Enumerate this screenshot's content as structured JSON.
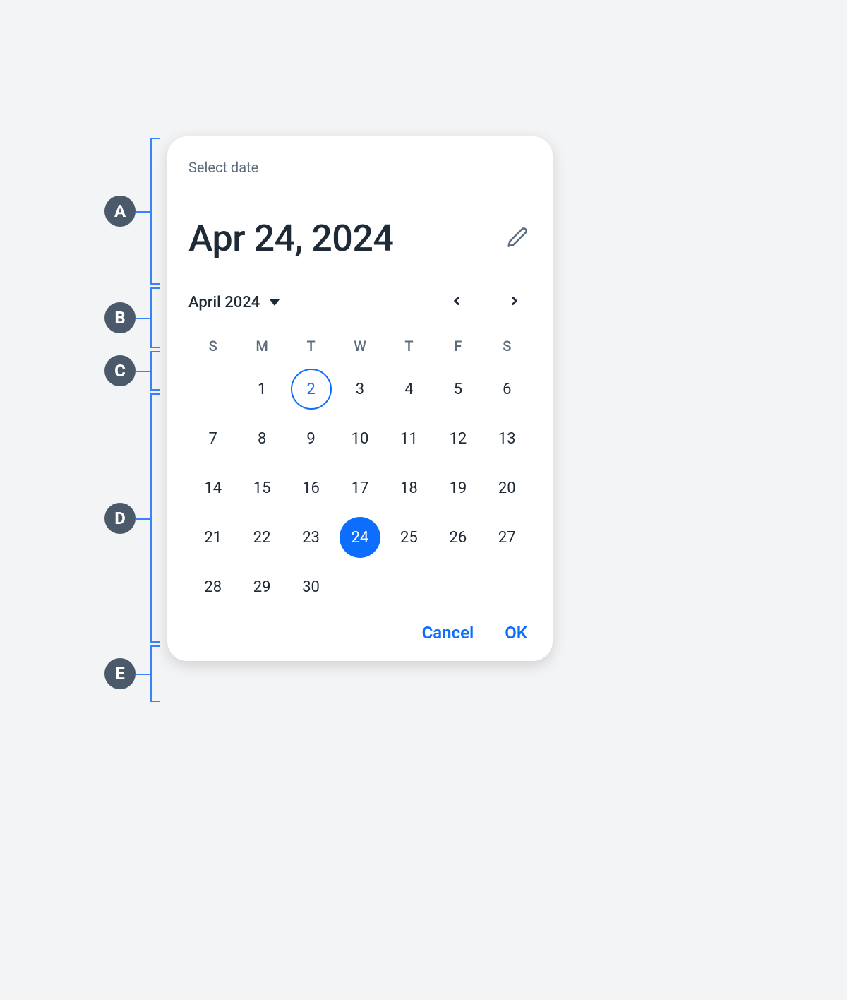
{
  "annotations": {
    "a": "A",
    "b": "B",
    "c": "C",
    "d": "D",
    "e": "E"
  },
  "header": {
    "supertitle": "Select date",
    "headline": "Apr 24, 2024"
  },
  "monthNav": {
    "label": "April 2024"
  },
  "daysOfWeek": [
    "S",
    "M",
    "T",
    "W",
    "T",
    "F",
    "S"
  ],
  "calendar": {
    "weeks": [
      [
        null,
        "1",
        "2",
        "3",
        "4",
        "5",
        "6"
      ],
      [
        "7",
        "8",
        "9",
        "10",
        "11",
        "12",
        "13"
      ],
      [
        "14",
        "15",
        "16",
        "17",
        "18",
        "19",
        "20"
      ],
      [
        "21",
        "22",
        "23",
        "24",
        "25",
        "26",
        "27"
      ],
      [
        "28",
        "29",
        "30",
        null,
        null,
        null,
        null
      ]
    ],
    "today": "2",
    "selected": "24"
  },
  "actions": {
    "cancel": "Cancel",
    "ok": "OK"
  },
  "colors": {
    "accent": "#0d6efd",
    "annotBg": "#4b5a6a"
  }
}
